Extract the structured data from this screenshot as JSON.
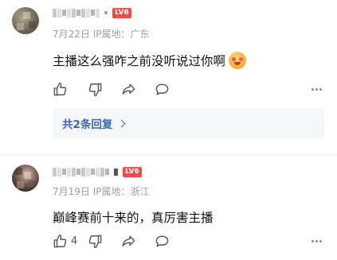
{
  "comments": [
    {
      "level_badge": "LV6",
      "date": "7月22日",
      "ip_label": "IP属地：",
      "ip_region": "广东",
      "text": "主播这么强咋之前没听说过你啊",
      "emoji_icon": "star-struck-emoji",
      "replies_label": "共2条回复",
      "like_count": ""
    },
    {
      "level_badge": "LV6",
      "date": "7月19日",
      "ip_label": "IP属地：",
      "ip_region": "浙江",
      "text": "巅峰赛前十来的，真厉害主播",
      "like_count": "4"
    }
  ],
  "colors": {
    "level_badge": "#f04b4b",
    "reply_link": "#3a68b0",
    "meta_text": "#9aa0a6"
  },
  "icons": [
    "thumbs-up-icon",
    "thumbs-down-icon",
    "share-icon",
    "comment-icon",
    "more-icon",
    "chevron-right-icon"
  ]
}
